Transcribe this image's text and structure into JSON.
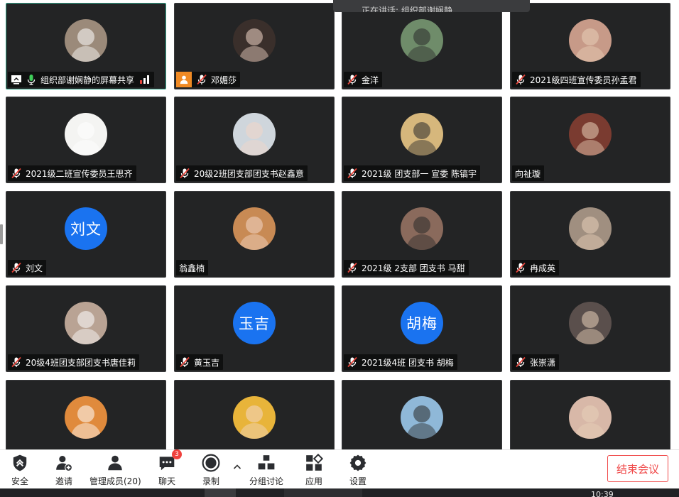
{
  "tooltip": {
    "text": "正在讲话: 组织部谢娴静"
  },
  "participants": [
    {
      "name": "组织部谢娴静的屏幕共享",
      "icon": "mic-on",
      "avatar": "photo",
      "color": "#9b8a7a",
      "active": true,
      "screen": true,
      "signal": true
    },
    {
      "name": "邓媚莎",
      "icon": "mic-muted",
      "avatar": "photo",
      "color": "#3a2f2b",
      "orange": true
    },
    {
      "name": "金洋",
      "icon": "mic-muted",
      "avatar": "photo",
      "color": "#6f8c6a"
    },
    {
      "name": "2021级四班宣传委员孙孟君",
      "icon": "mic-muted",
      "avatar": "photo",
      "color": "#c79a88"
    },
    {
      "name": "2021级二班宣传委员王思齐",
      "icon": "mic-muted",
      "avatar": "photo",
      "color": "#f4f4f2"
    },
    {
      "name": "20级2班团支部团支书赵鑫意",
      "icon": "mic-muted",
      "avatar": "photo",
      "color": "#cfd6dc"
    },
    {
      "name": "2021级 团支部一 宣委 陈镐宇",
      "icon": "mic-muted",
      "avatar": "photo",
      "color": "#d6b77c"
    },
    {
      "name": "向祉璇",
      "icon": "none",
      "avatar": "photo",
      "color": "#7a3b30"
    },
    {
      "name": "刘文",
      "icon": "mic-muted",
      "avatar": "text",
      "avatar_text": "刘文"
    },
    {
      "name": "翁鑫楠",
      "icon": "none",
      "avatar": "photo",
      "color": "#c88a54"
    },
    {
      "name": "2021级 2支部 团支书 马甜",
      "icon": "mic-muted",
      "avatar": "photo",
      "color": "#8a6a5c"
    },
    {
      "name": "冉成英",
      "icon": "mic-muted",
      "avatar": "photo",
      "color": "#a08f80"
    },
    {
      "name": "20级4班团支部团支书唐佳莉",
      "icon": "mic-muted",
      "avatar": "photo",
      "color": "#b9a394"
    },
    {
      "name": "黄玉吉",
      "icon": "mic-muted",
      "avatar": "text",
      "avatar_text": "玉吉"
    },
    {
      "name": "2021级4班 团支书 胡梅",
      "icon": "mic-muted",
      "avatar": "text",
      "avatar_text": "胡梅"
    },
    {
      "name": "张崇潇",
      "icon": "mic-muted",
      "avatar": "photo",
      "color": "#5a4f4c"
    },
    {
      "name": "",
      "icon": "none",
      "avatar": "photo",
      "color": "#e08a3c"
    },
    {
      "name": "",
      "icon": "none",
      "avatar": "photo",
      "color": "#e8b43a"
    },
    {
      "name": "",
      "icon": "none",
      "avatar": "photo",
      "color": "#8fb8d8"
    },
    {
      "name": "",
      "icon": "none",
      "avatar": "photo",
      "color": "#d8b8a8"
    }
  ],
  "toolbar": {
    "security": "安全",
    "invite": "邀请",
    "manage": "管理成员(20)",
    "chat": "聊天",
    "chat_badge": "3",
    "record": "录制",
    "breakout": "分组讨论",
    "apps": "应用",
    "settings": "设置",
    "end": "结束会议"
  },
  "taskbar": {
    "clock": "10:39"
  }
}
